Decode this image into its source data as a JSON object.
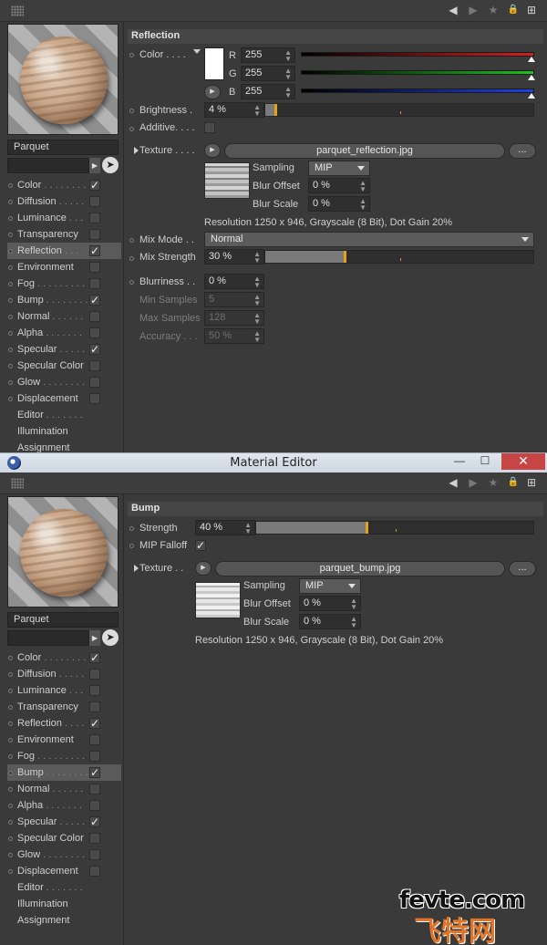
{
  "window": {
    "title": "Material Editor",
    "minimize": "—",
    "maximize": "☐",
    "close": "✕"
  },
  "toolbar": {
    "back": "◀",
    "forward": "▶",
    "favorite": "★",
    "lock": "🔒",
    "new": "⊞"
  },
  "material": {
    "name": "Parquet",
    "search_arrow": "▶",
    "cursor": "➤"
  },
  "panels": [
    {
      "channels": [
        {
          "label": "Color",
          "leader": " . . . . . . . .",
          "checked": true
        },
        {
          "label": "Diffusion",
          "leader": " . . . . .",
          "checked": false
        },
        {
          "label": "Luminance",
          "leader": " . . .",
          "checked": false
        },
        {
          "label": "Transparency",
          "leader": "",
          "checked": false
        },
        {
          "label": "Reflection",
          "leader": " . . .",
          "checked": true
        },
        {
          "label": "Environment",
          "leader": "",
          "checked": false
        },
        {
          "label": "Fog",
          "leader": " . . . . . . . . .",
          "checked": false
        },
        {
          "label": "Bump",
          "leader": " . . . . . . . .",
          "checked": true
        },
        {
          "label": "Normal",
          "leader": " . . . . . .",
          "checked": false
        },
        {
          "label": "Alpha",
          "leader": " . . . . . . .",
          "checked": false
        },
        {
          "label": "Specular",
          "leader": " . . . . .",
          "checked": true
        },
        {
          "label": "Specular Color",
          "leader": "",
          "checked": false
        },
        {
          "label": "Glow",
          "leader": " . . . . . . . .",
          "checked": false
        },
        {
          "label": "Displacement",
          "leader": "",
          "checked": false
        },
        {
          "label": "Editor",
          "leader": " . . . . . . .",
          "checked": null
        },
        {
          "label": "Illumination",
          "leader": "",
          "checked": null
        },
        {
          "label": "Assignment",
          "leader": "",
          "checked": null
        }
      ],
      "selected_index": 4
    },
    {
      "channels": [
        {
          "label": "Color",
          "leader": " . . . . . . . .",
          "checked": true
        },
        {
          "label": "Diffusion",
          "leader": " . . . . .",
          "checked": false
        },
        {
          "label": "Luminance",
          "leader": " . . .",
          "checked": false
        },
        {
          "label": "Transparency",
          "leader": "",
          "checked": false
        },
        {
          "label": "Reflection",
          "leader": " . . . .",
          "checked": true
        },
        {
          "label": "Environment",
          "leader": "",
          "checked": false
        },
        {
          "label": "Fog",
          "leader": " . . . . . . . . .",
          "checked": false
        },
        {
          "label": "Bump",
          "leader": " . . . . . . . .",
          "checked": true
        },
        {
          "label": "Normal",
          "leader": " . . . . . .",
          "checked": false
        },
        {
          "label": "Alpha",
          "leader": " . . . . . . .",
          "checked": false
        },
        {
          "label": "Specular",
          "leader": " . . . . .",
          "checked": true
        },
        {
          "label": "Specular Color",
          "leader": "",
          "checked": false
        },
        {
          "label": "Glow",
          "leader": " . . . . . . . .",
          "checked": false
        },
        {
          "label": "Displacement",
          "leader": "",
          "checked": false
        },
        {
          "label": "Editor",
          "leader": " . . . . . . .",
          "checked": null
        },
        {
          "label": "Illumination",
          "leader": "",
          "checked": null
        },
        {
          "label": "Assignment",
          "leader": "",
          "checked": null
        }
      ],
      "selected_index": 7
    }
  ],
  "reflection": {
    "header": "Reflection",
    "color_label": "Color . . . .",
    "r_label": "R",
    "r_value": "255",
    "g_label": "G",
    "g_value": "255",
    "b_label": "B",
    "b_value": "255",
    "color_swatch": "#ffffff",
    "brightness_label": "Brightness .",
    "brightness_value": "4 %",
    "brightness_level": 0.04,
    "additive_label": "Additive. . . .",
    "texture_label": "Texture . . . .",
    "texture_file": "parquet_reflection.jpg",
    "more": "...",
    "sampling_label": "Sampling",
    "sampling_value": "MIP",
    "blur_offset_label": "Blur Offset",
    "blur_offset_value": "0 %",
    "blur_scale_label": "Blur Scale",
    "blur_scale_value": "0 %",
    "resolution": "Resolution 1250 x 946, Grayscale (8 Bit), Dot Gain 20%",
    "mix_mode_label": "Mix Mode . .",
    "mix_mode_value": "Normal",
    "mix_strength_label": "Mix Strength",
    "mix_strength_value": "30 %",
    "mix_strength_level": 0.3,
    "blurriness_label": "Blurriness . .",
    "blurriness_value": "0 %",
    "min_samples_label": "Min Samples",
    "min_samples_value": "5",
    "max_samples_label": "Max Samples",
    "max_samples_value": "128",
    "accuracy_label": "Accuracy . . .",
    "accuracy_value": "50 %"
  },
  "bump": {
    "header": "Bump",
    "strength_label": "Strength",
    "strength_value": "40 %",
    "strength_level": 0.4,
    "mip_falloff_label": "MIP Falloff",
    "mip_falloff_checked": true,
    "texture_label": "Texture . .",
    "texture_file": "parquet_bump.jpg",
    "more": "...",
    "sampling_label": "Sampling",
    "sampling_value": "MIP",
    "blur_offset_label": "Blur Offset",
    "blur_offset_value": "0 %",
    "blur_scale_label": "Blur Scale",
    "blur_scale_value": "0 %",
    "resolution": "Resolution 1250 x 946, Grayscale (8 Bit), Dot Gain 20%"
  },
  "watermark": {
    "text": "fevte.com",
    "logo": "飞特网"
  },
  "colors": {
    "slider_marker": "#e5a11c",
    "red_bar": "#d02020",
    "green_bar": "#20c020",
    "blue_bar": "#2040e0"
  }
}
